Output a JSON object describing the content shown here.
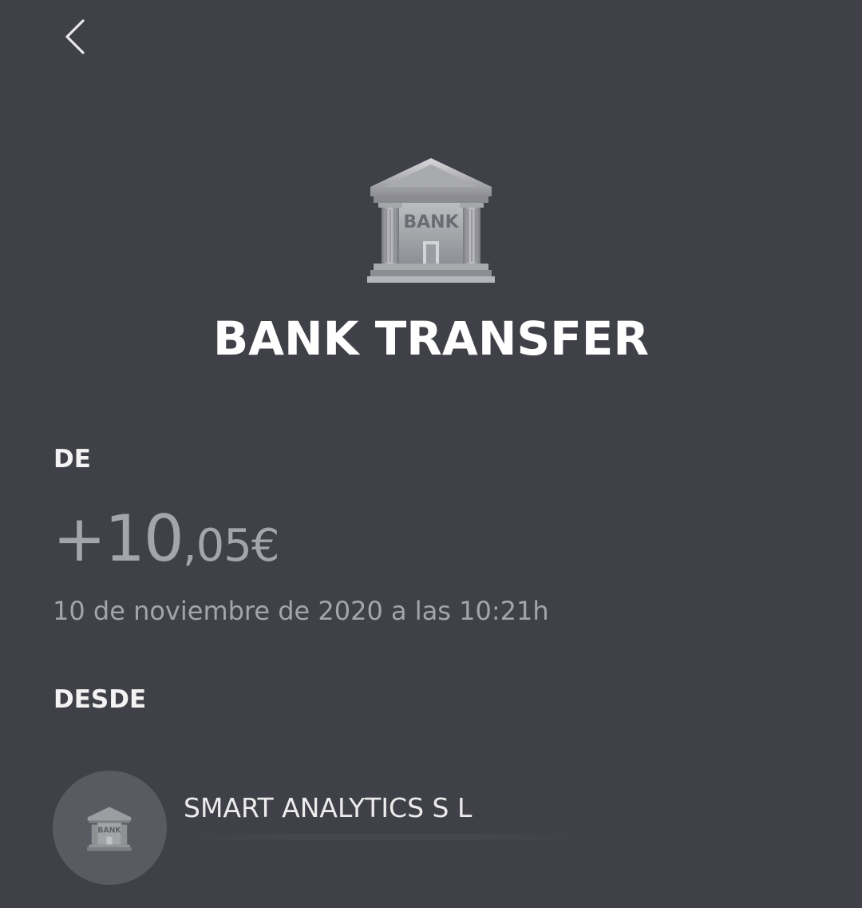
{
  "header": {
    "back_icon": "chevron-left-icon"
  },
  "hero": {
    "icon": "bank-building-icon",
    "icon_text": "BANK",
    "title": "BANK TRANSFER"
  },
  "transaction": {
    "de_label": "DE",
    "amount_int": "+10",
    "amount_dec": ",05€",
    "datetime": "10 de noviembre de 2020 a las 10:21h"
  },
  "sender": {
    "desde_label": "DESDE",
    "avatar_icon": "bank-building-icon",
    "avatar_icon_text": "BANK",
    "name": "SMART ANALYTICS S L"
  },
  "colors": {
    "background": "#3f4048",
    "muted_text": "#a4a5ab",
    "avatar_bg": "#5a5b62"
  }
}
